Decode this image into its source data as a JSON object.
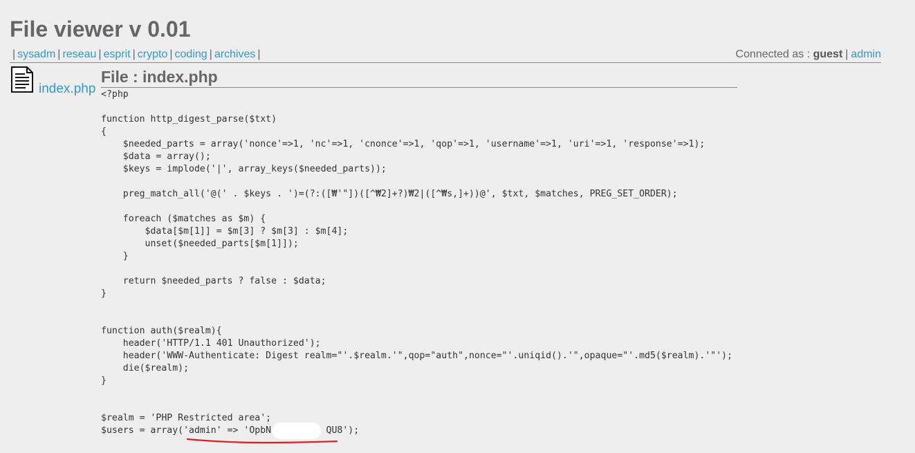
{
  "header": {
    "title": "File viewer v 0.01"
  },
  "nav": {
    "items": [
      {
        "label": "sysadm"
      },
      {
        "label": "reseau"
      },
      {
        "label": "esprit"
      },
      {
        "label": "crypto"
      },
      {
        "label": "coding"
      },
      {
        "label": "archives"
      }
    ],
    "separator": "|"
  },
  "user": {
    "prefix": "Connected as :",
    "name": "guest",
    "separator": "|",
    "admin_link": "admin"
  },
  "files": [
    {
      "name": "index.php",
      "icon": "document-icon"
    }
  ],
  "viewer": {
    "title": "File : index.php",
    "code": [
      "<?php",
      "",
      "function http_digest_parse($txt)",
      "{",
      "    $needed_parts = array('nonce'=>1, 'nc'=>1, 'cnonce'=>1, 'qop'=>1, 'username'=>1, 'uri'=>1, 'response'=>1);",
      "    $data = array();",
      "    $keys = implode('|', array_keys($needed_parts));",
      "",
      "    preg_match_all('@(' . $keys . ')=(?:([₩'\"])([^₩2]+?)₩2|([^₩s,]+))@', $txt, $matches, PREG_SET_ORDER);",
      "",
      "    foreach ($matches as $m) {",
      "        $data[$m[1]] = $m[3] ? $m[3] : $m[4];",
      "        unset($needed_parts[$m[1]]);",
      "    }",
      "",
      "    return $needed_parts ? false : $data;",
      "}",
      "",
      "",
      "function auth($realm){",
      "    header('HTTP/1.1 401 Unauthorized');",
      "    header('WWW-Authenticate: Digest realm=\"'.$realm.'\",qop=\"auth\",nonce=\"'.uniqid().'\",opaque=\"'.md5($realm).'\"');",
      "    die($realm);",
      "}",
      "",
      "",
      "$realm = 'PHP Restricted area';",
      "$users = array('admin' => 'OpbN          QU8');"
    ]
  },
  "colors": {
    "background": "#eeeeee",
    "link": "#3399cc",
    "annotation": "#e02020"
  }
}
